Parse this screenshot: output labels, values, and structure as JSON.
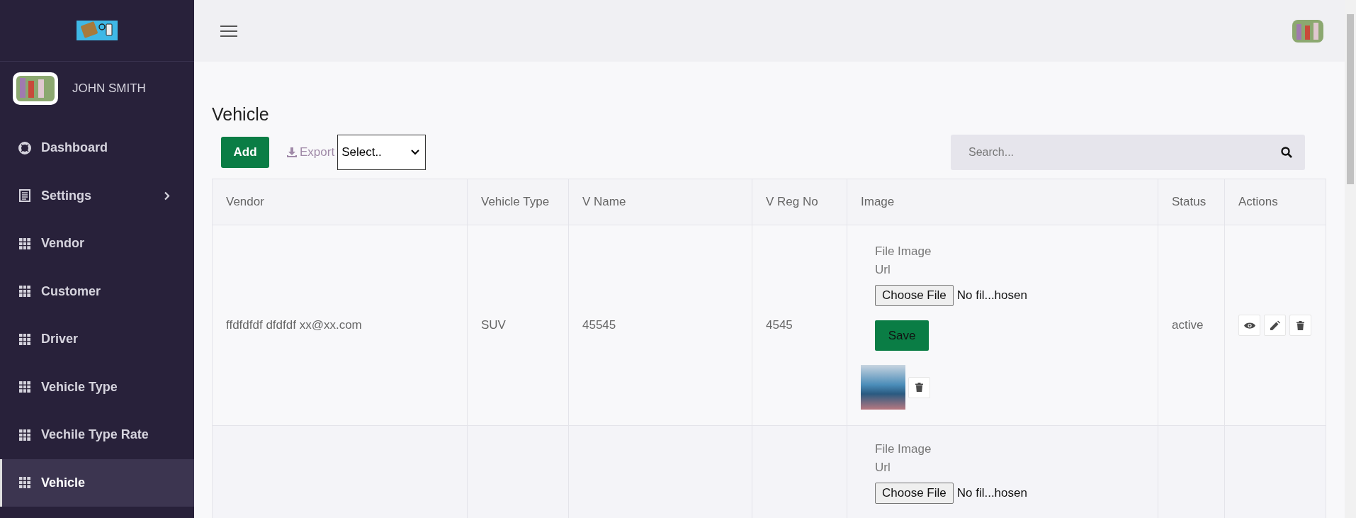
{
  "sidebar": {
    "user": {
      "name": "JOHN SMITH"
    },
    "items": [
      {
        "label": "Dashboard",
        "kind": "dashboard",
        "submenu": false,
        "selected": false
      },
      {
        "label": "Settings",
        "kind": "settings",
        "submenu": true,
        "selected": false
      },
      {
        "label": "Vendor",
        "kind": "table",
        "submenu": false,
        "selected": false
      },
      {
        "label": "Customer",
        "kind": "table",
        "submenu": false,
        "selected": false
      },
      {
        "label": "Driver",
        "kind": "table",
        "submenu": false,
        "selected": false
      },
      {
        "label": "Vehicle Type",
        "kind": "table",
        "submenu": false,
        "selected": false
      },
      {
        "label": "Vechile Type Rate",
        "kind": "table",
        "submenu": false,
        "selected": false
      },
      {
        "label": "Vehicle",
        "kind": "table",
        "submenu": false,
        "selected": true
      }
    ]
  },
  "page": {
    "title": "Vehicle",
    "add_button": "Add",
    "export_button": "Export",
    "select": {
      "value": "Select.."
    },
    "search": {
      "placeholder": "Search..."
    }
  },
  "table": {
    "columns": [
      "Vendor",
      "Vehicle Type",
      "V Name",
      "V Reg No",
      "Image",
      "Status",
      "Actions"
    ],
    "rows": [
      {
        "vendor": "ffdfdfdf dfdfdf xx@xx.com",
        "vehicle_type": "SUV",
        "v_name": "45545",
        "v_reg_no": "4545",
        "image": {
          "label": "File Image Url",
          "choose_button": "Choose File",
          "file_status": "No fil...hosen",
          "save_button": "Save",
          "thumbnail": true
        },
        "status": "active",
        "actions": true
      },
      {
        "image": {
          "label": "File Image Url",
          "choose_button": "Choose File",
          "file_status": "No fil...hosen"
        },
        "actions": false
      }
    ]
  }
}
